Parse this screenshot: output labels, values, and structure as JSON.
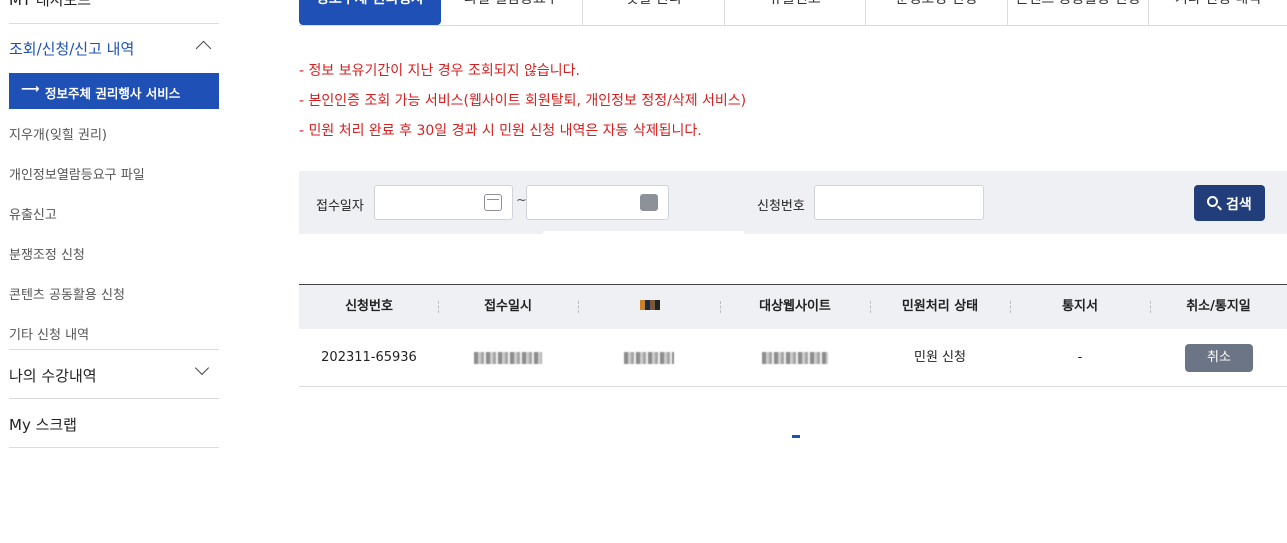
{
  "sidebar": {
    "top_item": "MY 대시보드",
    "group_title": "조회/신청/신고 내역",
    "active_item": "정보주체 권리행사 서비스",
    "sub_items": [
      "지우개(잊힐 권리)",
      "개인정보열람등요구 파일",
      "유출신고",
      "분쟁조정 신청",
      "콘텐츠 공동활용 신청",
      "기타 신청 내역"
    ],
    "major_items": [
      "나의 수강내역",
      "My 스크랩"
    ]
  },
  "tabs": [
    "정보주체 권리행사",
    "파일 열람등요구",
    "잊힐 권리",
    "유출신고",
    "분쟁조정 신청",
    "콘텐츠 공동활용 신청",
    "기타 신청 내역"
  ],
  "notices": [
    "- 정보 보유기간이 지난 경우 조회되지 않습니다.",
    "- 본인인증 조회 가능 서비스(웹사이트 회원탈퇴, 개인정보 정정/삭제 서비스)",
    "- 민원 처리 완료 후 30일 경과 시 민원 신청 내역은 자동 삭제됩니다."
  ],
  "search": {
    "date_label": "접수일자",
    "date_sep": "~",
    "app_no_label": "신청번호",
    "button_label": "검색"
  },
  "table": {
    "headers": [
      "신청번호",
      "접수일시",
      "",
      "대상웹사이트",
      "민원처리 상태",
      "통지서",
      "취소/통지일"
    ],
    "rows": [
      {
        "app_no": "202311-65936",
        "status": "민원 신청",
        "notice": "-",
        "action": "취소"
      }
    ]
  },
  "colors": {
    "primary": "#1f50b5",
    "notice_red": "#d61f1f",
    "search_btn": "#213e7a",
    "cancel_btn": "#6b7585"
  }
}
